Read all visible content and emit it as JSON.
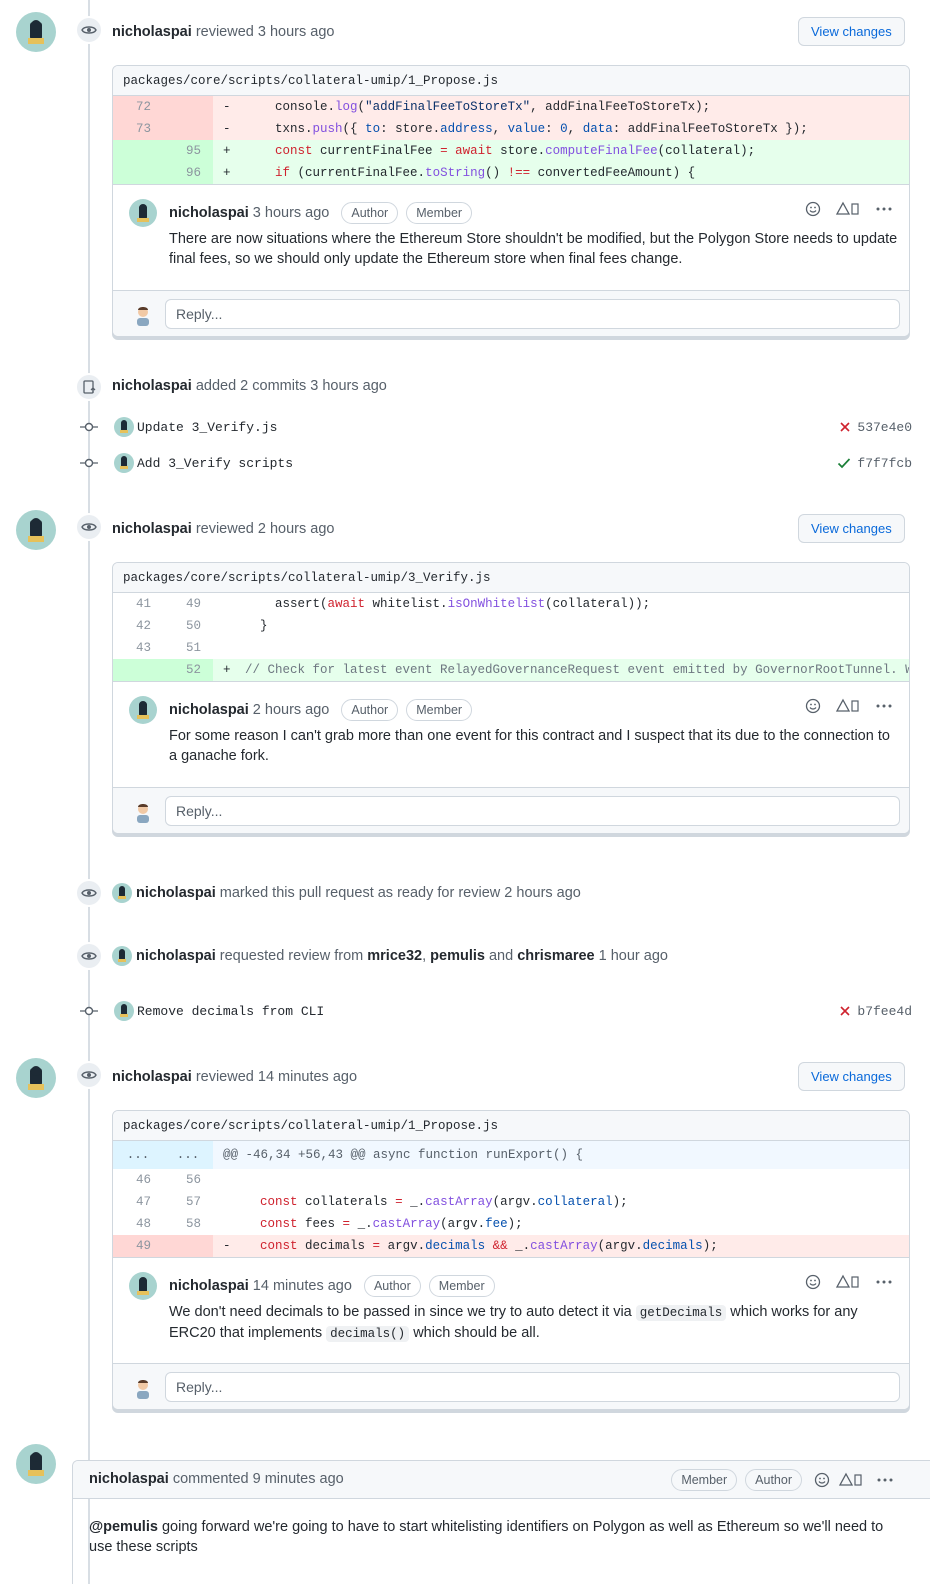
{
  "colors": {
    "accent": "#0969da",
    "add_bg": "#e6ffec",
    "del_bg": "#ffebe9",
    "fail": "#cf222e",
    "success": "#1a7f37"
  },
  "reviews": [
    {
      "author": "nicholaspai",
      "action": "reviewed",
      "time": "3 hours ago",
      "button": "View changes",
      "file": "packages/core/scripts/collateral-umip/1_Propose.js",
      "comment": {
        "author": "nicholaspai",
        "time": "3 hours ago",
        "badges": [
          "Author",
          "Member"
        ],
        "body": "There are now situations where the Ethereum Store shouldn't be modified, but the Polygon Store needs to update final fees, so we should only update the Ethereum store when final fees change."
      },
      "reply_placeholder": "Reply..."
    },
    {
      "author": "nicholaspai",
      "action": "reviewed",
      "time": "2 hours ago",
      "button": "View changes",
      "file": "packages/core/scripts/collateral-umip/3_Verify.js",
      "comment": {
        "author": "nicholaspai",
        "time": "2 hours ago",
        "badges": [
          "Author",
          "Member"
        ],
        "body": "For some reason I can't grab more than one event for this contract and I suspect that its due to the connection to a ganache fork."
      },
      "reply_placeholder": "Reply..."
    },
    {
      "author": "nicholaspai",
      "action": "reviewed",
      "time": "14 minutes ago",
      "button": "View changes",
      "file": "packages/core/scripts/collateral-umip/1_Propose.js",
      "comment": {
        "author": "nicholaspai",
        "time": "14 minutes ago",
        "badges": [
          "Author",
          "Member"
        ],
        "body_parts": [
          "We don't need decimals to be passed in since we try to auto detect it via ",
          "getDecimals",
          " which works for any ERC20 that implements ",
          "decimals()",
          " which should be all."
        ]
      },
      "reply_placeholder": "Reply..."
    }
  ],
  "diff1": {
    "rows": [
      {
        "old": "72",
        "new": "",
        "sign": "-"
      },
      {
        "old": "73",
        "new": "",
        "sign": "-"
      },
      {
        "old": "",
        "new": "95",
        "sign": "+"
      },
      {
        "old": "",
        "new": "96",
        "sign": "+"
      }
    ],
    "code": {
      "r0_a": "console.",
      "r0_fn": "log",
      "r0_b": "(",
      "r0_str": "\"addFinalFeeToStoreTx\"",
      "r0_c": ", addFinalFeeToStoreTx);",
      "r1_a": "txns.",
      "r1_fn": "push",
      "r1_b": "({ ",
      "r1_k1": "to",
      "r1_c": ": store.",
      "r1_k2": "address",
      "r1_d": ", ",
      "r1_k3": "value",
      "r1_e": ": ",
      "r1_n": "0",
      "r1_f": ", ",
      "r1_k4": "data",
      "r1_g": ": addFinalFeeToStoreTx });",
      "r2_kw": "const",
      "r2_a": " currentFinalFee ",
      "r2_eq": "=",
      "r2_sp": " ",
      "r2_aw": "await",
      "r2_b": " store.",
      "r2_fn": "computeFinalFee",
      "r2_c": "(collateral);",
      "r3_kw": "if",
      "r3_a": " (currentFinalFee.",
      "r3_fn": "toString",
      "r3_b": "() ",
      "r3_op": "!==",
      "r3_c": " convertedFeeAmount) {"
    }
  },
  "commits_event": {
    "author": "nicholaspai",
    "text": "added 2 commits",
    "time": "3 hours ago"
  },
  "commits": [
    {
      "message": "Update 3_Verify.js",
      "sha": "537e4e0",
      "status": "fail"
    },
    {
      "message": "Add 3_Verify scripts",
      "sha": "f7f7fcb",
      "status": "success"
    }
  ],
  "diff2": {
    "rows": [
      {
        "old": "41",
        "new": "49",
        "sign": ""
      },
      {
        "old": "42",
        "new": "50",
        "sign": ""
      },
      {
        "old": "43",
        "new": "51",
        "sign": ""
      },
      {
        "old": "",
        "new": "52",
        "sign": "+"
      }
    ],
    "code": {
      "r0_a": "assert(",
      "r0_aw": "await",
      "r0_b": " whitelist.",
      "r0_fn": "isOnWhitelist",
      "r0_c": "(collateral));",
      "r1": "}",
      "r3": "// Check for latest event RelayedGovernanceRequest event emitted by GovernorRootTunnel. We c"
    }
  },
  "ready_event": {
    "author": "nicholaspai",
    "text": "marked this pull request as ready for review",
    "time": "2 hours ago"
  },
  "review_request": {
    "author": "nicholaspai",
    "text": "requested review from",
    "reviewers": [
      "mrice32",
      "pemulis",
      "chrismaree"
    ],
    "sep1": ",",
    "and": "and",
    "time": "1 hour ago"
  },
  "commit3": {
    "message": "Remove decimals from CLI",
    "sha": "b7fee4d",
    "status": "fail"
  },
  "diff3": {
    "hunk": {
      "old": "...",
      "new": "...",
      "text": "@@ -46,34 +56,43 @@ async function runExport() {"
    },
    "rows": [
      {
        "old": "46",
        "new": "56",
        "sign": ""
      },
      {
        "old": "47",
        "new": "57",
        "sign": ""
      },
      {
        "old": "48",
        "new": "58",
        "sign": ""
      },
      {
        "old": "49",
        "new": "",
        "sign": "-"
      }
    ],
    "code": {
      "r1_kw": "const",
      "r1_a": " collaterals ",
      "r1_eq": "=",
      "r1_b": " _.",
      "r1_fn": "castArray",
      "r1_c": "(argv.",
      "r1_p": "collateral",
      "r1_d": ");",
      "r2_kw": "const",
      "r2_a": " fees ",
      "r2_eq": "=",
      "r2_b": " _.",
      "r2_fn": "castArray",
      "r2_c": "(argv.",
      "r2_p": "fee",
      "r2_d": ");",
      "r3_kw": "const",
      "r3_a": " decimals ",
      "r3_eq": "=",
      "r3_b": " argv.",
      "r3_p": "decimals",
      "r3_sp": " ",
      "r3_op": "&&",
      "r3_c": " _.",
      "r3_fn": "castArray",
      "r3_d": "(argv.",
      "r3_p2": "decimals",
      "r3_e": ");"
    }
  },
  "final_comment": {
    "author": "nicholaspai",
    "action": "commented",
    "time": "9 minutes ago",
    "badges": [
      "Member",
      "Author"
    ],
    "mention": "@pemulis",
    "body": " going forward we're going to have to start whitelisting identifiers on Polygon as well as Ethereum so we'll need to use these scripts"
  }
}
